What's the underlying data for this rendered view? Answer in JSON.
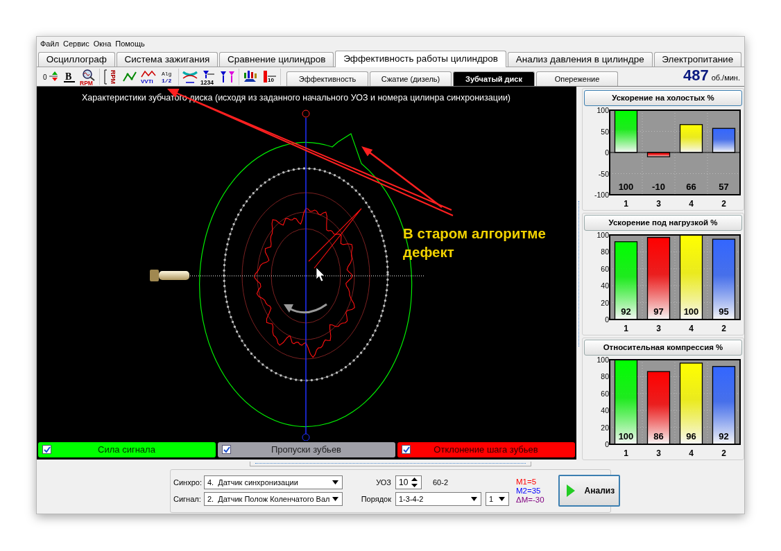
{
  "menu": [
    "Файл",
    "Сервис",
    "Окна",
    "Помощь"
  ],
  "tabs": [
    {
      "label": "Осциллограф",
      "selected": false
    },
    {
      "label": "Система зажигания",
      "selected": false
    },
    {
      "label": "Сравнение цилиндров",
      "selected": false
    },
    {
      "label": "Эффективность работы цилиндров",
      "selected": true
    },
    {
      "label": "Анализ давления в цилиндре",
      "selected": false
    },
    {
      "label": "Электропитание",
      "selected": false
    }
  ],
  "toolbar": {
    "groups": [
      [
        {
          "kind": "updown",
          "text": "0"
        },
        {
          "kind": "bold",
          "text": "B"
        },
        {
          "kind": "rpmzoom",
          "text": "RPM"
        }
      ],
      [
        {
          "kind": "rpmscale",
          "text": "RPM"
        },
        {
          "kind": "line"
        },
        {
          "kind": "vvti",
          "text": "VVTi"
        },
        {
          "kind": "alg",
          "text": "Alg",
          "text2": "1/2"
        }
      ],
      [
        {
          "kind": "filter"
        },
        {
          "kind": "tfilter",
          "text": "1234"
        },
        {
          "kind": "tpair"
        }
      ],
      [
        {
          "kind": "bars"
        },
        {
          "kind": "bar10",
          "text": "10"
        }
      ]
    ]
  },
  "subtabs": [
    {
      "label": "Эффективность",
      "selected": false
    },
    {
      "label": "Сжатие (дизель)",
      "selected": false
    },
    {
      "label": "Зубчатый диск",
      "selected": true
    },
    {
      "label": "Опережение",
      "selected": false
    }
  ],
  "rpm": {
    "value": "487",
    "unit": "об./мин."
  },
  "plot": {
    "title": "Характеристики зубчатого диска (исходя из заданного начального УОЗ и номера цилинра синхронизации)",
    "annotation": "В старом алгоритме\nдефект"
  },
  "legend": [
    {
      "kind": "signal",
      "label": "Сила сигнала",
      "checked": true,
      "color": "#00ff00"
    },
    {
      "kind": "gaps",
      "label": "Пропуски зубьев",
      "checked": true,
      "color": "#a0a0a8"
    },
    {
      "kind": "deviation",
      "label": "Отклонение шага зубьев",
      "checked": true,
      "color": "#ff0000"
    }
  ],
  "charts": [
    {
      "chart_data": {
        "type": "bar",
        "title": "Ускорение на холостых %",
        "categories": [
          "1",
          "3",
          "4",
          "2"
        ],
        "series": [
          {
            "values": [
              100,
              -10,
              66,
              57
            ]
          }
        ],
        "ylim": [
          -100,
          100
        ],
        "yticks": [
          -100,
          -50,
          0,
          50,
          100
        ],
        "grid": true,
        "value_labels": [
          "100",
          "-10",
          "66",
          "57"
        ]
      }
    },
    {
      "chart_data": {
        "type": "bar",
        "title": "Ускорение под нагрузкой %",
        "categories": [
          "1",
          "3",
          "4",
          "2"
        ],
        "series": [
          {
            "values": [
              92,
              97,
              100,
              95
            ]
          }
        ],
        "ylim": [
          0,
          100
        ],
        "yticks": [
          0,
          20,
          40,
          60,
          80,
          100
        ],
        "grid": true,
        "value_labels": [
          "92",
          "97",
          "100",
          "95"
        ]
      }
    },
    {
      "chart_data": {
        "type": "bar",
        "title": "Относительная компрессия %",
        "categories": [
          "1",
          "3",
          "4",
          "2"
        ],
        "series": [
          {
            "values": [
              100,
              86,
              96,
              92
            ]
          }
        ],
        "ylim": [
          0,
          100
        ],
        "yticks": [
          0,
          20,
          40,
          60,
          80,
          100
        ],
        "grid": true,
        "value_labels": [
          "100",
          "86",
          "96",
          "92"
        ]
      }
    }
  ],
  "controls": {
    "sync": {
      "label": "Синхро:",
      "value": "4.  Датчик синхронизации"
    },
    "signal": {
      "label": "Сигнал:",
      "value": "2.  Датчик Полож Коленчатого Вал"
    },
    "uoz": {
      "label": "УОЗ",
      "value": "10"
    },
    "teeth": "60-2",
    "order": {
      "label": "Порядок",
      "value": "1-3-4-2"
    },
    "cylinder": {
      "value": "1"
    },
    "markers": [
      {
        "text": "M1=5",
        "color": "#ff0000"
      },
      {
        "text": "M2=35",
        "color": "#0000ff"
      },
      {
        "text": "ΔM=-30",
        "color": "#800080"
      }
    ],
    "button": "Анализ"
  }
}
